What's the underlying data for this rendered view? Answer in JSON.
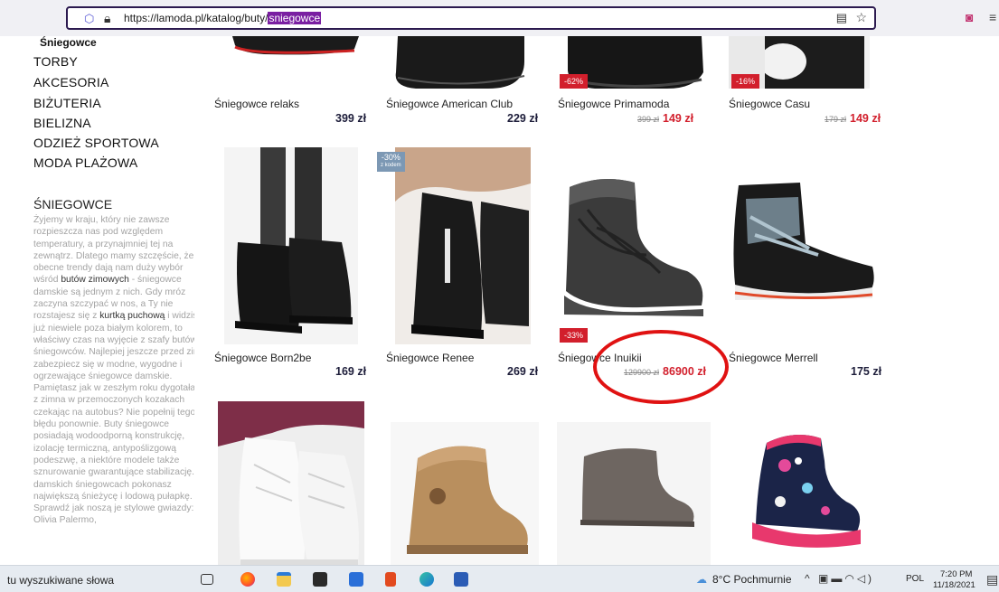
{
  "browser": {
    "url_prefix": "https://lamoda.pl/katalog/buty/",
    "url_highlight": "sniegowce",
    "icons": [
      "shield-icon",
      "lock-icon",
      "reader-view-icon",
      "bookmark-star-icon",
      "pocket-icon",
      "menu-icon"
    ]
  },
  "sidebar": {
    "active_subcategory": "Śniegowce",
    "categories": [
      "TORBY",
      "AKCESORIA",
      "BIŻUTERIA",
      "BIELIZNA",
      "ODZIEŻ SPORTOWA",
      "MODA PLAŻOWA"
    ],
    "seo_title": "ŚNIEGOWCE",
    "seo_text_1": "Żyjemy w kraju, który nie zawsze rozpieszcza nas pod względem temperatury, a przynajmniej tej na zewnątrz. Dlatego mamy szczęście, że obecne trendy dają nam duży wybór wśród ",
    "seo_link_1": "butów zimowych",
    "seo_text_2": " - śniegowce damskie są jednym z nich. Gdy mróz zaczyna szczypać w nos, a Ty nie rozstajesz się z ",
    "seo_link_2": "kurtką puchową",
    "seo_text_3": " i widzisz już niewiele poza białym kolorem, to właściwy czas na wyjęcie z szafy butów śniegowców. Najlepiej jeszcze przed zimą zabezpiecz się w modne, wygodne i ogrzewające śniegowce damskie. Pamiętasz jak w zeszłym roku dygotałaś z zimna w przemoczonych kozakach czekając na autobus? Nie popełnij tego błędu ponownie. Buty śniegowce posiadają wodoodporną konstrukcję, izolację termiczną, antypoślizgową podeszwę, a niektóre modele także sznurowanie gwarantujące stabilizację. W damskich śniegowcach pokonasz największą śnieżycę i lodową pułapkę. Sprawdź jak noszą je stylowe gwiazdy: Olivia Palermo,"
  },
  "products_row1": [
    {
      "name": "Śniegowce relaks",
      "price": "399 zł"
    },
    {
      "name": "Śniegowce American Club",
      "price": "229 zł"
    },
    {
      "name": "Śniegowce Primamoda",
      "badge": "-62%",
      "old_price": "399 zł",
      "price": "149 zł"
    },
    {
      "name": "Śniegowce Casu",
      "badge": "-16%",
      "old_price": "179 zł",
      "price": "149 zł"
    }
  ],
  "products_row2": [
    {
      "name": "Śniegowce Born2be",
      "price": "169 zł"
    },
    {
      "name": "Śniegowce Renee",
      "badge_line1": "-30%",
      "badge_line2": "z kodem",
      "price": "269 zł"
    },
    {
      "name": "Śniegowce Inuikii",
      "badge": "-33%",
      "old_price": "129900 zł",
      "price": "86900 zł"
    },
    {
      "name": "Śniegowce Merrell",
      "price": "175 zł"
    }
  ],
  "taskbar": {
    "search_placeholder": "tu wyszukiwane słowa",
    "weather": "8°C Pochmurnie",
    "language": "POL",
    "time": "7:20 PM",
    "date": "11/18/2021",
    "app_icons": [
      "task-view-icon",
      "firefox-icon",
      "file-explorer-icon",
      "store-icon",
      "mail-icon",
      "office-icon",
      "edge-icon",
      "word-icon"
    ]
  }
}
